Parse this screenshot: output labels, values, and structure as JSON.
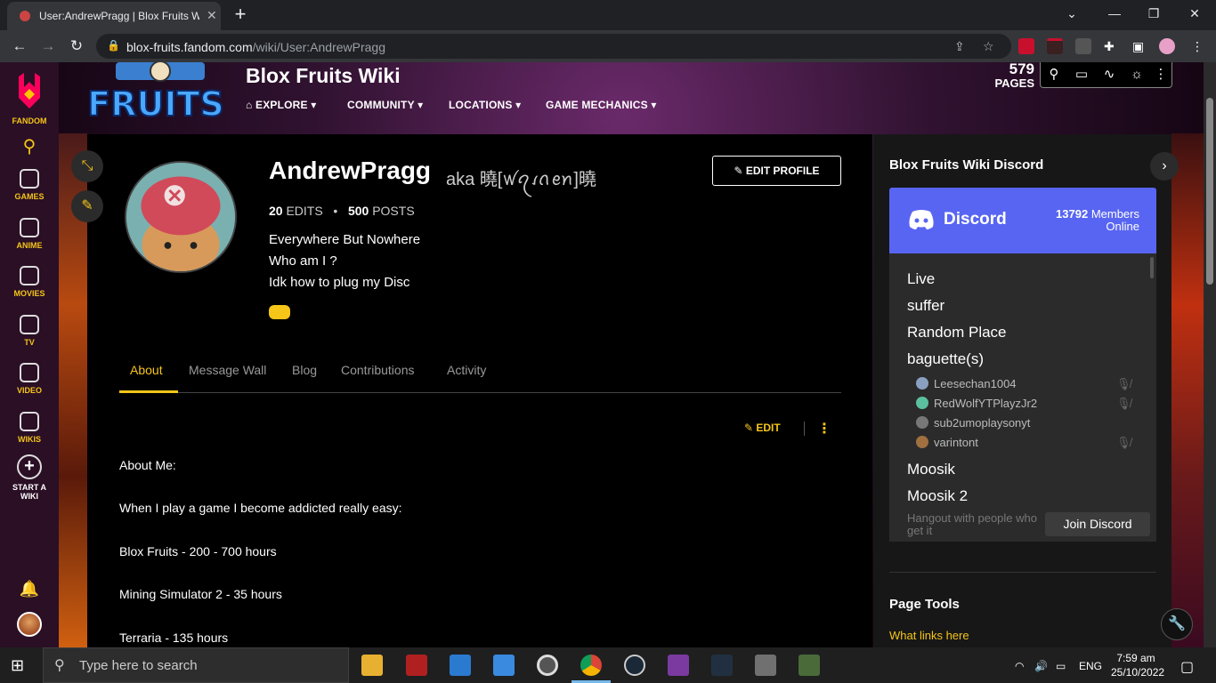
{
  "browser": {
    "tab_title": "User:AndrewPragg | Blox Fruits Wiki",
    "new_tab": "+",
    "url_domain": "blox-fruits.fandom.com",
    "url_path": "/wiki/User:AndrewPragg"
  },
  "rail": {
    "items": [
      {
        "label": "FANDOM"
      },
      {
        "label": "GAMES"
      },
      {
        "label": "ANIME"
      },
      {
        "label": "MOVIES"
      },
      {
        "label": "TV"
      },
      {
        "label": "VIDEO"
      },
      {
        "label": "WIKIS"
      },
      {
        "label": "START A WIKI"
      }
    ]
  },
  "wiki": {
    "name": "Blox Fruits Wiki",
    "nav": [
      "EXPLORE",
      "COMMUNITY",
      "LOCATIONS",
      "GAME MECHANICS"
    ],
    "page_count": "579",
    "page_count_label": "PAGES"
  },
  "profile": {
    "username": "AndrewPragg",
    "aka": "aka 曉[ꪝꪖꪹꪒꫀꪀ]曉",
    "edits_count": "20",
    "edits_label": "EDITS",
    "posts_count": "500",
    "posts_label": "POSTS",
    "bio": [
      "Everywhere But Nowhere",
      "Who am I ?",
      "Idk how to plug my Disc"
    ],
    "edit_profile_label": "EDIT PROFILE"
  },
  "tabs": [
    "About",
    "Message Wall",
    "Blog",
    "Contributions",
    "Activity"
  ],
  "edit_label": "EDIT",
  "about_lines": [
    "About Me:",
    "When I play a game I become addicted really easy:",
    "Blox Fruits - 200 - 700 hours",
    "Mining Simulator 2 - 35 hours",
    "Terraria - 135 hours"
  ],
  "discord": {
    "title": "Blox Fruits Wiki Discord",
    "brand": "Discord",
    "members_count": "13792",
    "members_label": "Members",
    "online_label": "Online",
    "channels": [
      "Live",
      "suffer",
      "Random Place",
      "baguette(s)",
      "Moosik",
      "Moosik 2"
    ],
    "members": [
      "Leesechan1004",
      "RedWolfYTPlayzJr2",
      "sub2umoplaysonyt",
      "varintont"
    ],
    "footer_text": "Hangout with people who get it",
    "join_label": "Join Discord"
  },
  "page_tools": {
    "title": "Page Tools",
    "link": "What links here"
  },
  "taskbar": {
    "search_placeholder": "Type here to search",
    "lang": "ENG",
    "time": "7:59 am",
    "date": "25/10/2022"
  },
  "colors": {
    "accent": "#f5c518",
    "discord": "#5865f2",
    "rail_bg": "#2a0f25"
  }
}
